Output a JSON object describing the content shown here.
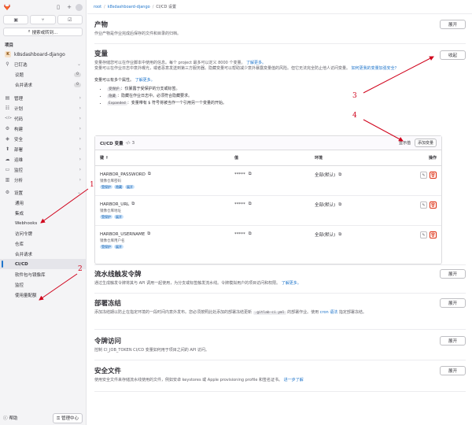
{
  "sidebar": {
    "search_label": "搜索或转到...",
    "section_label": "项目",
    "project_initial": "K",
    "project_name": "k8sdashboard-django",
    "items": [
      {
        "icon": "pin-icon",
        "glyph": "⚲",
        "label": "已钉选",
        "expanded": true
      },
      {
        "icon": "book-icon",
        "glyph": "▤",
        "label": "管理"
      },
      {
        "icon": "list-icon",
        "glyph": "☷",
        "label": "计划"
      },
      {
        "icon": "code-icon",
        "glyph": "</>",
        "label": "代码"
      },
      {
        "icon": "rocket-icon",
        "glyph": "⚙",
        "label": "构建"
      },
      {
        "icon": "shield-icon",
        "glyph": "◈",
        "label": "安全"
      },
      {
        "icon": "deploy-icon",
        "glyph": "⬆",
        "label": "部署"
      },
      {
        "icon": "cloud-icon",
        "glyph": "☁",
        "label": "运维"
      },
      {
        "icon": "monitor-icon",
        "glyph": "▭",
        "label": "监控"
      },
      {
        "icon": "chart-icon",
        "glyph": "▥",
        "label": "分析"
      },
      {
        "icon": "settings-icon",
        "glyph": "⚙",
        "label": "设置"
      }
    ],
    "pinned": [
      {
        "label": "议题",
        "count": "0"
      },
      {
        "label": "合并请求",
        "count": "0"
      }
    ],
    "settings_sub": [
      "通用",
      "集成",
      "Webhooks",
      "访问令牌",
      "仓库",
      "合并请求",
      "CI/CD",
      "软件包与镜像库",
      "监控",
      "使用量配额"
    ],
    "help": "帮助",
    "admin": "管理中心"
  },
  "breadcrumb": [
    "root",
    "k8sdashboard-django",
    "CI/CD 设置"
  ],
  "artifacts": {
    "title": "产物",
    "desc": "作业产物是作业完成后保存的文件和目录的归档。",
    "button": "展开"
  },
  "variables": {
    "title": "变量",
    "desc1": "变量存储您可以在作业脚本中使用的信息。每个 project 最多可以定义 8000 个变量。",
    "learn_more": "了解更多。",
    "desc2": "变量可以在作业日志中意外曝光，或者恶意发送到第三方服务器。隐藏变量可以帮助减少意外暴露变量值的风险。但它无法完全防止他人访问变量。",
    "desc2_link": "如何更我的变量加强安全？",
    "button": "收起",
    "attrs_intro": "变量可以有多个属性。",
    "attrs_link": "了解更多。",
    "bullets": [
      {
        "code": "受保护",
        "text": "：仅暴露于受保护的分支或标签。"
      },
      {
        "code": "隐藏",
        "text": "：隐藏在作业日志中。必须符合隐藏要求。"
      },
      {
        "code": "Expanded",
        "text": "：变量带有 $ 符号将被当作一个引用另一个变量的开始。"
      }
    ]
  },
  "cicd": {
    "title": "CI/CD 变量",
    "count": "3",
    "show_values": "显示值",
    "add": "添加变量",
    "headers": {
      "key": "键",
      "value": "值",
      "env": "环境",
      "actions": "操作"
    },
    "rows": [
      {
        "key": "HARBOR_PASSWORD",
        "desc": "镜像仓库密码",
        "tags": [
          "受保护",
          "隐藏",
          "展开"
        ],
        "value": "*****",
        "env": "全部(默认)"
      },
      {
        "key": "HARBOR_URL",
        "desc": "镜像仓库地址",
        "tags": [
          "受保护",
          "展开"
        ],
        "value": "*****",
        "env": "全部(默认)"
      },
      {
        "key": "HARBOR_USERNAME",
        "desc": "镜像仓库用户名",
        "tags": [
          "受保护",
          "展开"
        ],
        "value": "*****",
        "env": "全部(默认)"
      }
    ]
  },
  "triggers": {
    "title": "流水线触发令牌",
    "desc": "通过生成触发令牌将其与 API 调用一起使用，为分支或标签触发流水线。令牌模拟用户的项目访问和权限。",
    "link": "了解更多。",
    "button": "展开"
  },
  "freeze": {
    "title": "部署冻结",
    "desc_a": "添加冻结期以防止在指定环境的一段时间内意外发布。您必须按照此处添加的部署冻结更新",
    "code": ".gitlab-ci.yml",
    "desc_b": "的部署作业。使用",
    "link1": "cron 语法",
    "desc_c": "指定部署冻结。",
    "button": "展开"
  },
  "token_access": {
    "title": "令牌访问",
    "desc": "控制 CI_JOB_TOKEN CI/CD 变量如何用于项目之间的 API 访问。",
    "button": "展开"
  },
  "secure_files": {
    "title": "安全文件",
    "desc": "使用安全文件来存储流水线使用的文件，例如安卓 keystores 或 Apple provisioning profile 和签名证书。",
    "link": "进一步了解",
    "button": "展开"
  },
  "annotations": [
    "1",
    "2",
    "3",
    "4"
  ],
  "colors": {
    "accent": "#1f75cb",
    "annotation": "#d0021b",
    "tag_bg": "#cbe2f9",
    "danger": "#dd2b0e"
  }
}
